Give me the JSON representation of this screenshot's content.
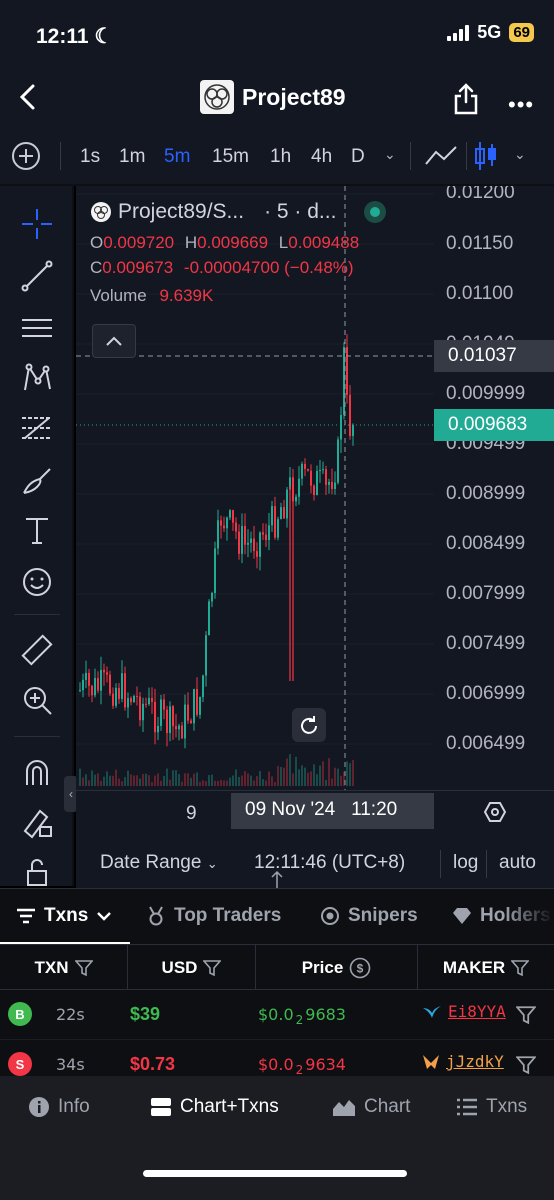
{
  "status_bar": {
    "time": "12:11",
    "network": "5G",
    "battery": "69"
  },
  "header": {
    "title": "Project89"
  },
  "timeframes": {
    "items": [
      "1s",
      "1m",
      "5m",
      "15m",
      "1h",
      "4h",
      "D"
    ],
    "active": "5m"
  },
  "legend": {
    "symbol": "Project89/S...",
    "interval": "· 5 · d...",
    "o_label": "O",
    "o_value": "0.009720",
    "h_label": "H",
    "h_value": "0.009669",
    "l_label": "L",
    "l_value": "0.009488",
    "c_label": "C",
    "c_value": "0.009673",
    "change": "-0.00004700 (−0.48%)",
    "volume_label": "Volume",
    "volume_value": "9.639K"
  },
  "price_scale": {
    "ticks": [
      "0.01200",
      "0.01150",
      "0.01100",
      "0.01049",
      "0.009999",
      "0.009499",
      "0.008999",
      "0.008499",
      "0.007999",
      "0.007499",
      "0.006999",
      "0.006499"
    ],
    "crosshair_price": "0.01037",
    "last_price": "0.009683"
  },
  "time_axis": {
    "tick": "9",
    "crosshair_time": "09 Nov '24   11:20"
  },
  "chart_footer": {
    "date_range": "Date Range",
    "clock": "12:11:46 (UTC+8)",
    "log": "log",
    "auto": "auto"
  },
  "colors": {
    "up": "#22ab94",
    "down": "#f23645",
    "accent": "#2962ff",
    "bg": "#131722"
  },
  "tabs": [
    "Txns",
    "Top Traders",
    "Snipers",
    "Holders"
  ],
  "table": {
    "headers": [
      "TXN",
      "USD",
      "Price",
      "MAKER"
    ],
    "rows": [
      {
        "side": "B",
        "age": "22s",
        "usd": "$39",
        "price_prefix": "$0.0",
        "price_sub": "2",
        "price_rest": "9683",
        "maker": "Ei8YYA",
        "type": "buy"
      },
      {
        "side": "S",
        "age": "34s",
        "usd": "$0.73",
        "price_prefix": "$0.0",
        "price_sub": "2",
        "price_rest": "9634",
        "maker": "jJzdkY",
        "type": "sell"
      }
    ]
  },
  "bottom_nav": [
    "Info",
    "Chart+Txns",
    "Chart",
    "Txns"
  ]
}
